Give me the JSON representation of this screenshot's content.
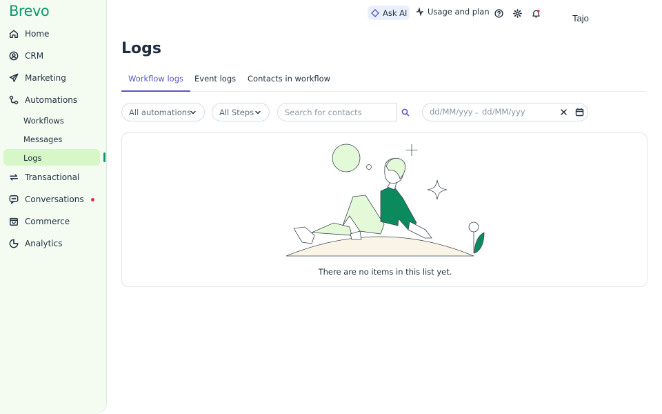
{
  "brand": {
    "name": "Brevo",
    "color": "#0b996e"
  },
  "sidebar": {
    "items": [
      {
        "label": "Home",
        "icon": "home-icon"
      },
      {
        "label": "CRM",
        "icon": "contact-icon"
      },
      {
        "label": "Marketing",
        "icon": "send-icon"
      },
      {
        "label": "Automations",
        "icon": "automation-icon"
      },
      {
        "label": "Transactional",
        "icon": "arrows-icon"
      },
      {
        "label": "Conversations",
        "icon": "chat-icon"
      },
      {
        "label": "Commerce",
        "icon": "bag-icon"
      },
      {
        "label": "Analytics",
        "icon": "pie-chart-icon"
      }
    ],
    "sub_items": [
      "Workflows",
      "Messages",
      "Logs"
    ],
    "active_sub": "Logs"
  },
  "topbar": {
    "ask_ai": "Ask AI",
    "usage": "Usage and plan",
    "user": "Tajo"
  },
  "page": {
    "title": "Logs",
    "tabs": [
      "Workflow logs",
      "Event logs",
      "Contacts in workflow"
    ],
    "active_tab": "Workflow logs"
  },
  "filters": {
    "automations": "All automations",
    "steps": "All Steps",
    "search_placeholder": "Search for contacts",
    "date_from_placeholder": "dd/MM/yyyy",
    "date_to_placeholder": "dd/MM/yyyy",
    "date_separator": "-"
  },
  "empty_state": {
    "message": "There are no items in this list yet."
  },
  "colors": {
    "accent": "#5a55c8",
    "active_bg": "#d7f7c8",
    "notification": "#d9344c"
  }
}
